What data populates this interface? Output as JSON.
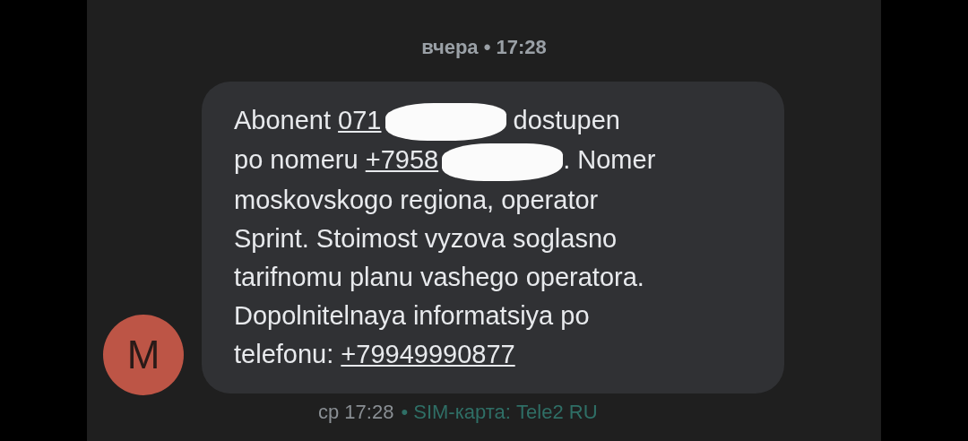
{
  "date_header": "вчера • 17:28",
  "message": {
    "sender_initial": "M",
    "lines": [
      [
        {
          "kind": "text",
          "text": "Abonent "
        },
        {
          "kind": "link",
          "text": "071"
        },
        {
          "kind": "redaction"
        },
        {
          "kind": "text",
          "text": " dostupen"
        }
      ],
      [
        {
          "kind": "text",
          "text": "po nomeru "
        },
        {
          "kind": "link",
          "text": "+7958"
        },
        {
          "kind": "redaction"
        },
        {
          "kind": "text",
          "text": ". Nomer"
        }
      ],
      [
        {
          "kind": "text",
          "text": "moskovskogo regiona, operator"
        }
      ],
      [
        {
          "kind": "text",
          "text": "Sprint. Stoimost vyzova soglasno"
        }
      ],
      [
        {
          "kind": "text",
          "text": "tarifnomu planu vashego operatora."
        }
      ],
      [
        {
          "kind": "text",
          "text": "Dopolnitelnaya informatsiya po"
        }
      ],
      [
        {
          "kind": "text",
          "text": "telefonu: "
        },
        {
          "kind": "link",
          "text": "+79949990877"
        }
      ]
    ],
    "time": "ср 17:28",
    "sim": "• SIM-карта: Tele2 RU"
  }
}
